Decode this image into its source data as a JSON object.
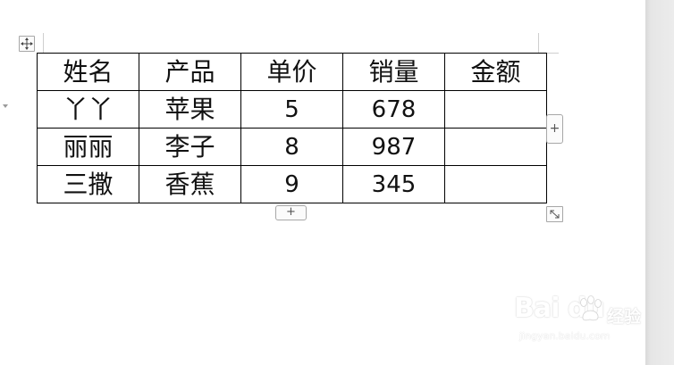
{
  "table": {
    "header": [
      "姓名",
      "产品",
      "单价",
      "销量",
      "金额"
    ],
    "rows": [
      [
        "丫丫",
        "苹果",
        "5",
        "678",
        ""
      ],
      [
        "丽丽",
        "李子",
        "8",
        "987",
        ""
      ],
      [
        "三撒",
        "香蕉",
        "9",
        "345",
        ""
      ]
    ]
  },
  "controls": {
    "add_column_glyph": "+",
    "add_row_glyph": "+",
    "move_handle_icon": "move-arrows-icon",
    "resize_handle_icon": "resize-diagonal-icon"
  },
  "watermark": {
    "logo": "Bai du",
    "brand_cn": "经验",
    "url": "jingyan.baidu.com"
  },
  "colors": {
    "table_border": "#000000",
    "gutter": "#e6e6e6",
    "handle_border": "#a7a7a7"
  }
}
